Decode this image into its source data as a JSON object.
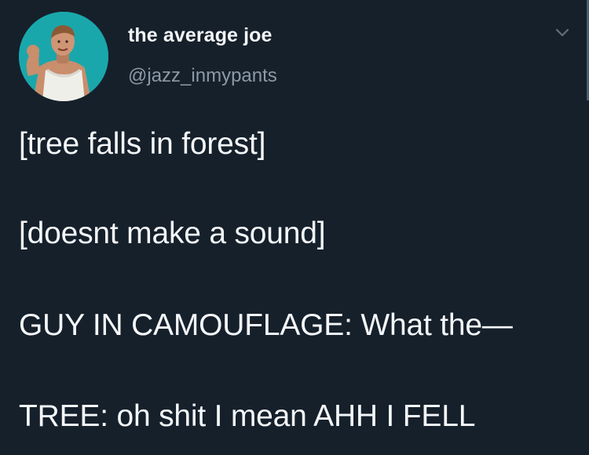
{
  "tweet": {
    "author": {
      "display_name": "the average joe",
      "handle": "@jazz_inmypants",
      "avatar_icon": "profile-photo"
    },
    "menu_icon": "chevron-down-icon",
    "lines": [
      "[tree falls in forest]",
      "[doesnt make a sound]",
      "GUY IN CAMOUFLAGE: What the—",
      "TREE: oh shit I mean AHH I FELL"
    ]
  },
  "colors": {
    "background": "#16202b",
    "primary_text": "#f4f7f9",
    "secondary_text": "#8c9aa6",
    "avatar_background": "#1aa7ab"
  }
}
